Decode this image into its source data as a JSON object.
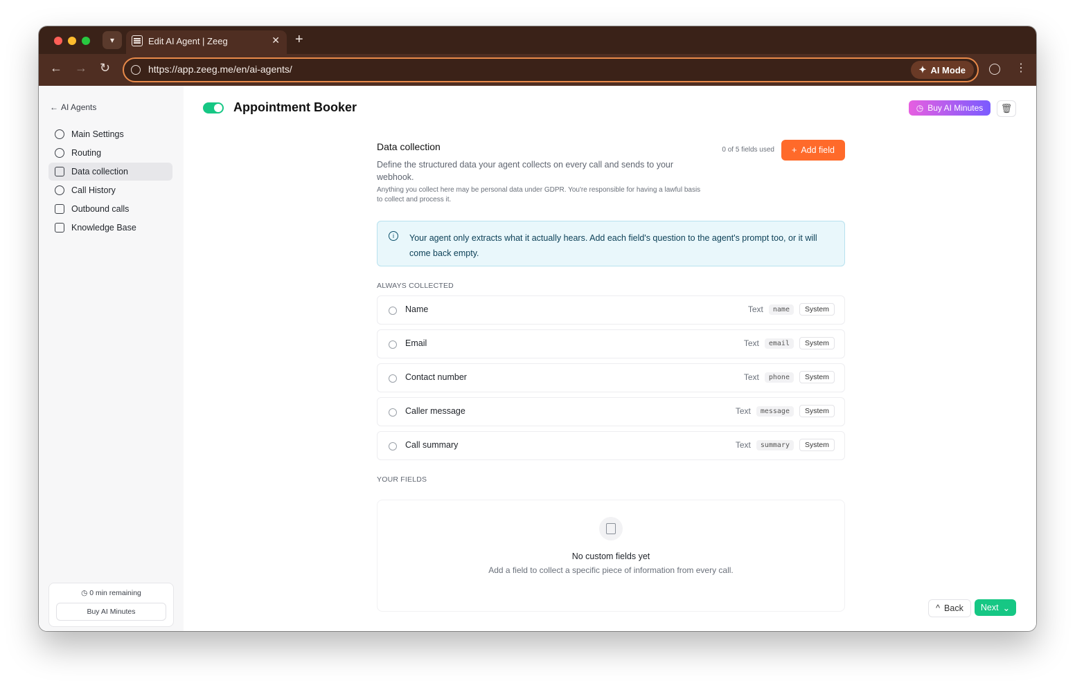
{
  "browser": {
    "tab_title": "Edit AI Agent | Zeeg",
    "url": "https://app.zeeg.me/en/ai-agents/",
    "ai_mode_label": "AI Mode"
  },
  "sidebar": {
    "back_label": "AI Agents",
    "items": [
      {
        "label": "Main Settings",
        "icon": "gear-icon"
      },
      {
        "label": "Routing",
        "icon": "route-icon"
      },
      {
        "label": "Data collection",
        "icon": "table-icon",
        "active": true
      },
      {
        "label": "Call History",
        "icon": "microphone-icon"
      },
      {
        "label": "Outbound calls",
        "icon": "phone-icon"
      },
      {
        "label": "Knowledge Base",
        "icon": "book-icon"
      }
    ],
    "remaining": "0 min remaining",
    "buy_minutes_label": "Buy AI Minutes"
  },
  "header": {
    "title": "Appointment Booker",
    "buy_button_label": "Buy AI Minutes",
    "toggle_on": true
  },
  "data_collection": {
    "title": "Data collection",
    "description": "Define the structured data your agent collects on every call and sends to your webhook.",
    "gdpr_note": "Anything you collect here may be personal data under GDPR. You're responsible for having a lawful basis to collect and process it.",
    "fields_used": "0 of 5 fields used",
    "add_field_label": "Add field",
    "info": "Your agent only extracts what it actually hears. Add each field's question to the agent's prompt too, or it will come back empty.",
    "always_collected_heading": "ALWAYS COLLECTED",
    "always_collected": [
      {
        "name": "Name",
        "type": "Text",
        "key": "name",
        "badge": "System"
      },
      {
        "name": "Email",
        "type": "Text",
        "key": "email",
        "badge": "System"
      },
      {
        "name": "Contact number",
        "type": "Text",
        "key": "phone",
        "badge": "System"
      },
      {
        "name": "Caller message",
        "type": "Text",
        "key": "message",
        "badge": "System"
      },
      {
        "name": "Call summary",
        "type": "Text",
        "key": "summary",
        "badge": "System"
      }
    ],
    "your_fields_heading": "YOUR FIELDS",
    "empty_title": "No custom fields yet",
    "empty_desc": "Add a field to collect a specific piece of information from every call."
  },
  "footer": {
    "back_label": "Back",
    "next_label": "Next"
  },
  "colors": {
    "accent_green": "#16c784",
    "accent_orange": "#ff6a2a",
    "browser_chrome": "#4f2e22"
  }
}
